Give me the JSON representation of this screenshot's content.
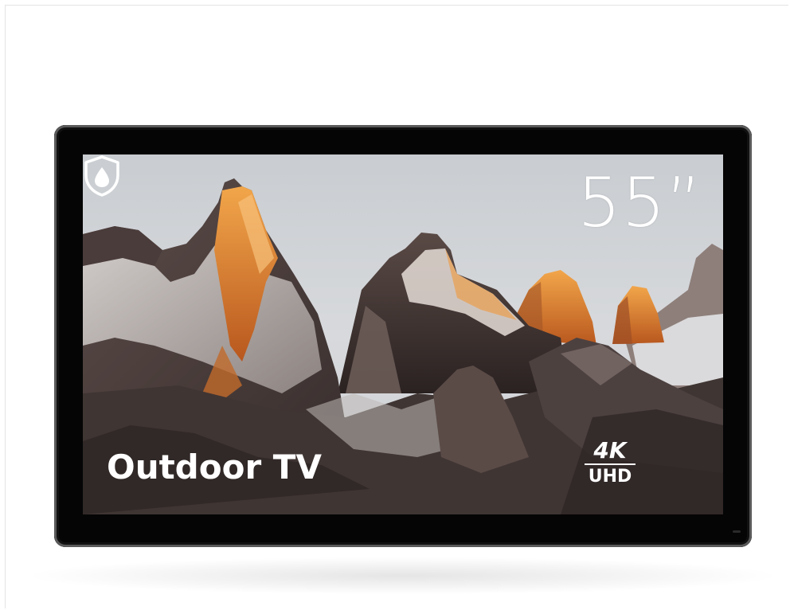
{
  "tv": {
    "size_label": "55”",
    "title": "Outdoor TV",
    "badge_top": "4K",
    "badge_bottom": "UHD"
  },
  "icons": {
    "badge": "4k-uhd-icon",
    "weatherproof": "water-shield-icon"
  },
  "colors": {
    "bezel": "#050505",
    "sky": "#d3d6da",
    "peak_light": "#e08a30",
    "rock_dark": "#4b3f3d"
  }
}
